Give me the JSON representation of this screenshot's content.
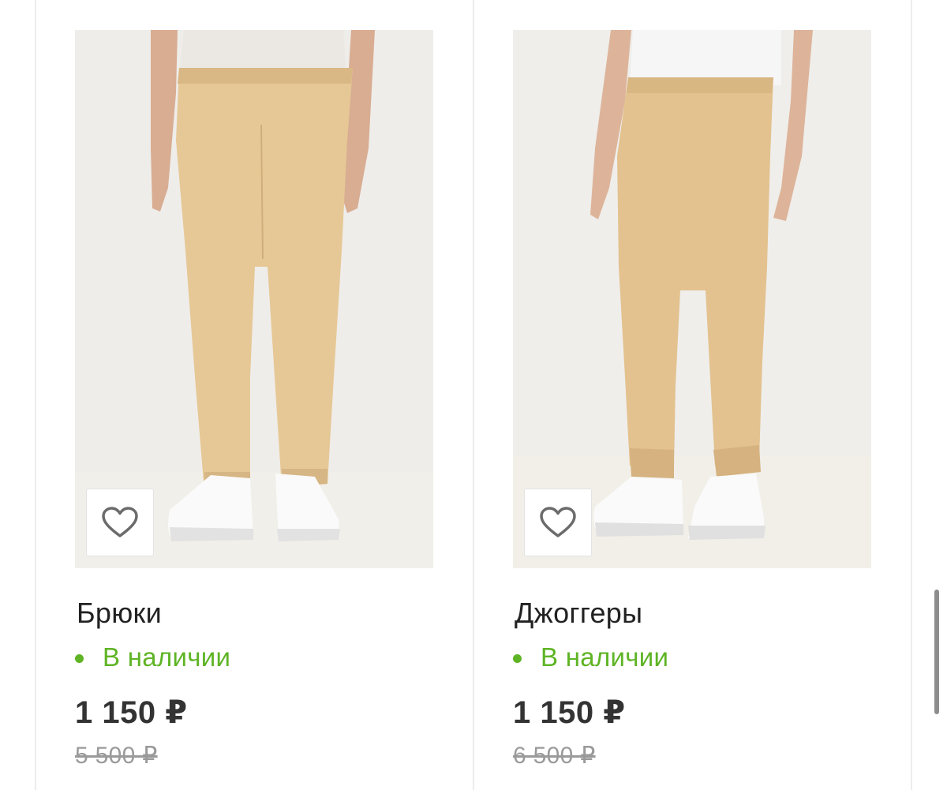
{
  "products": [
    {
      "title": "Брюки",
      "availability": "В наличии",
      "price": "1 150 ₽",
      "old_price": "5 500 ₽",
      "image_icon": "beige-trousers-photo",
      "favorite_icon": "heart-outline-icon"
    },
    {
      "title": "Джоггеры",
      "availability": "В наличии",
      "price": "1 150 ₽",
      "old_price": "6 500 ₽",
      "image_icon": "beige-joggers-photo",
      "favorite_icon": "heart-outline-icon"
    }
  ],
  "colors": {
    "in_stock": "#5fb425",
    "price": "#333333",
    "old_price": "#9a9a9a",
    "pants": "#e6c896"
  }
}
